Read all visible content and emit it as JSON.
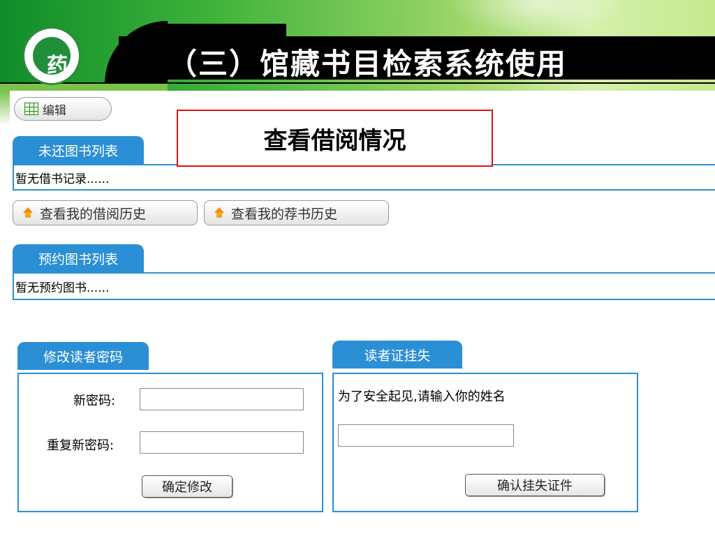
{
  "slide": {
    "title": "（三）馆藏书目检索系统使用",
    "logo_mark": "药",
    "callout": "查看借阅情况"
  },
  "toolbar": {
    "edit_label": "编辑",
    "edit_icon": "grid-icon"
  },
  "unreturned": {
    "tab_label": "未还图书列表",
    "empty_text": "暂无借书记录......"
  },
  "history_buttons": [
    {
      "label": "查看我的借阅历史",
      "icon": "up-arrow-icon"
    },
    {
      "label": "查看我的荐书历史",
      "icon": "up-arrow-icon"
    }
  ],
  "reservations": {
    "tab_label": "预约图书列表",
    "empty_text": "暂无预约图书......"
  },
  "change_password": {
    "tab_label": "修改读者密码",
    "new_password_label": "新密码:",
    "new_password_value": "",
    "repeat_password_label": "重复新密码:",
    "repeat_password_value": "",
    "submit_label": "确定修改"
  },
  "report_loss": {
    "tab_label": "读者证挂失",
    "instruction": "为了安全起见,请输入你的姓名",
    "name_value": "",
    "submit_label": "确认挂失证件"
  },
  "colors": {
    "tab_blue": "#2b8fd6",
    "header_green": "#3fb33a",
    "callout_red": "#e01010"
  }
}
